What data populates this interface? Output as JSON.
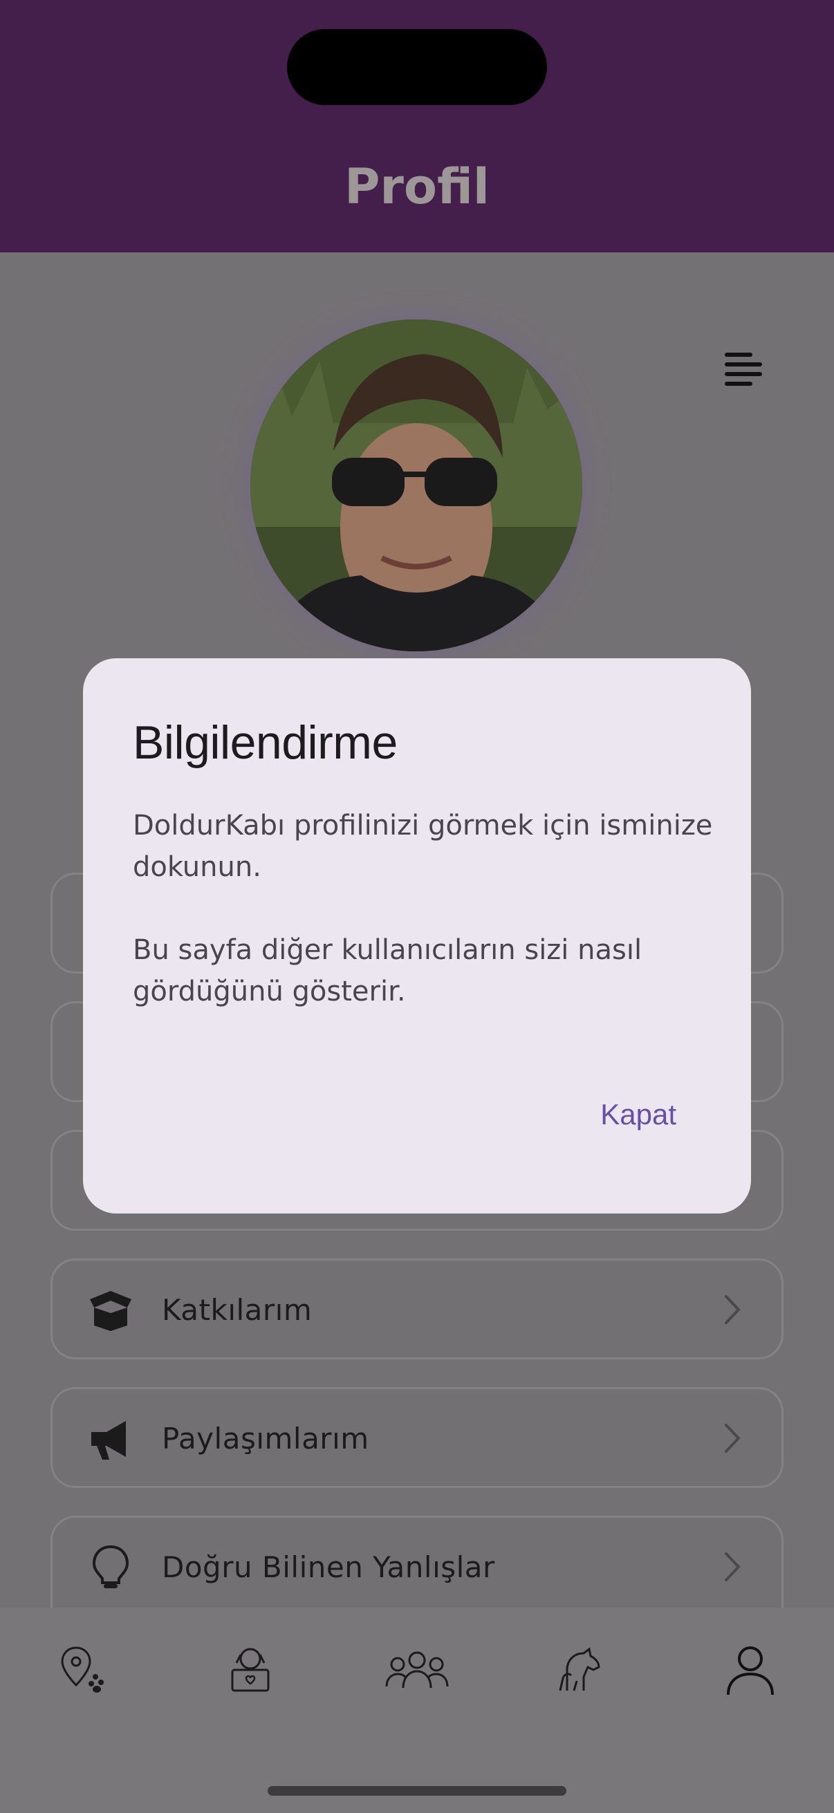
{
  "header": {
    "title": "Profil"
  },
  "menu": [
    {
      "label": "Katkılarım",
      "icon": "box-icon"
    },
    {
      "label": "Paylaşımlarım",
      "icon": "megaphone-icon"
    },
    {
      "label": "Doğru Bilinen Yanlışlar",
      "icon": "lightbulb-icon"
    }
  ],
  "dialog": {
    "title": "Bilgilendirme",
    "paragraph1": "DoldurKabı profilinizi görmek için isminize dokunun.",
    "paragraph2": "Bu sayfa diğer kullanıcıların sizi nasıl gördüğünü gösterir.",
    "close_label": "Kapat"
  },
  "tabs": [
    {
      "icon": "map-pin-paw-icon"
    },
    {
      "icon": "pet-box-icon"
    },
    {
      "icon": "community-icon"
    },
    {
      "icon": "pets-icon"
    },
    {
      "icon": "profile-icon"
    }
  ],
  "colors": {
    "header": "#451f4b",
    "accent": "#6750a4",
    "dialog_bg": "#ece6f0"
  }
}
